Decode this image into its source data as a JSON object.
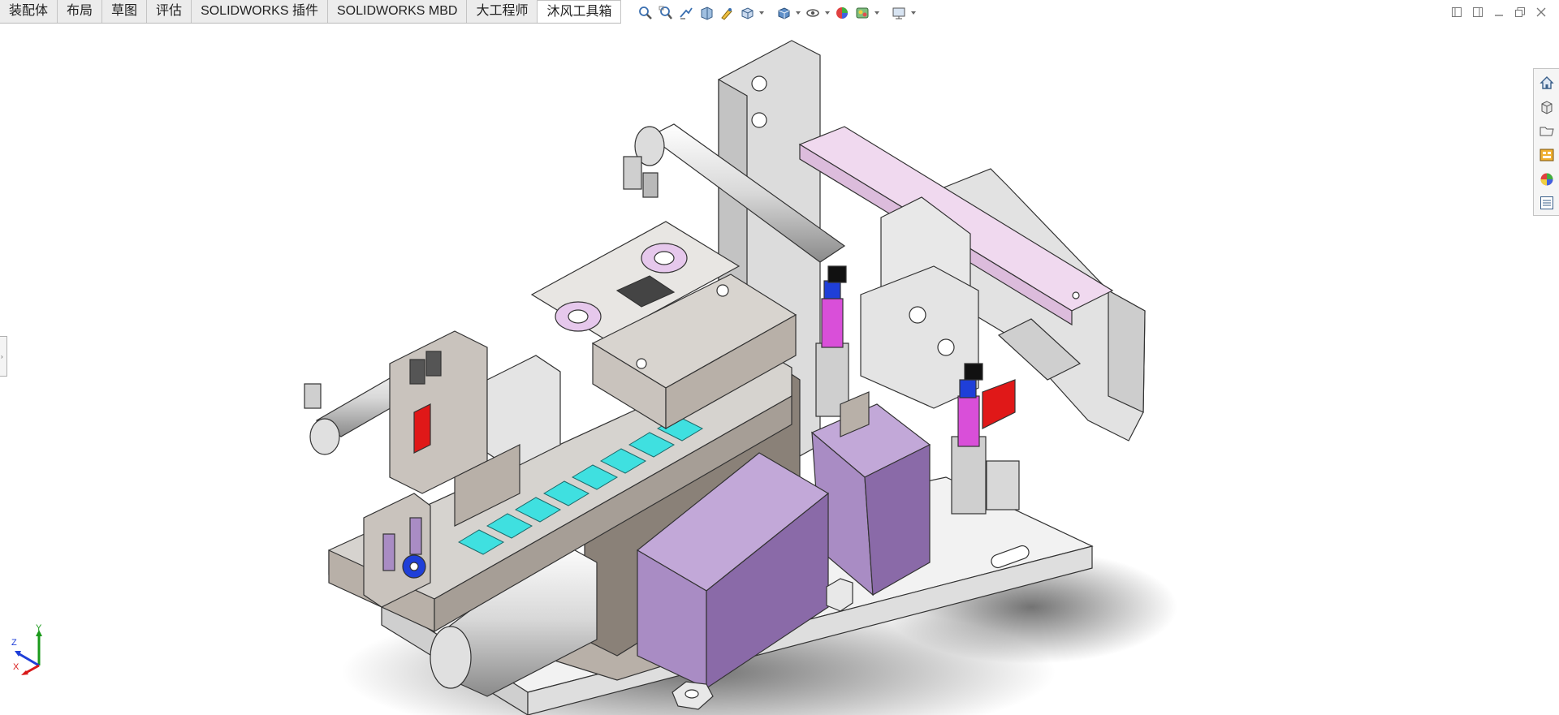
{
  "tabs": [
    {
      "label": "装配体",
      "active": false
    },
    {
      "label": "布局",
      "active": false
    },
    {
      "label": "草图",
      "active": false
    },
    {
      "label": "评估",
      "active": false
    },
    {
      "label": "SOLIDWORKS 插件",
      "active": false
    },
    {
      "label": "SOLIDWORKS MBD",
      "active": false
    },
    {
      "label": "大工程师",
      "active": false
    },
    {
      "label": "沐风工具箱",
      "active": true
    }
  ],
  "hud_toolbar": [
    "zoom-to-fit-icon",
    "zoom-to-area-icon",
    "previous-view-icon",
    "section-view-icon",
    "dynamic-annotation-icon",
    "view-orientation-icon",
    "display-style-icon",
    "hide-show-items-icon",
    "edit-appearance-icon",
    "apply-scene-icon",
    "view-settings-icon"
  ],
  "task_pane": [
    "solidworks-resources-icon",
    "design-library-icon",
    "file-explorer-icon",
    "view-palette-icon",
    "appearances-scenes-icon",
    "custom-properties-icon"
  ],
  "triad": {
    "x": "X",
    "y": "Y",
    "z": "Z"
  },
  "colors": {
    "part_gray": "#d6d3cf",
    "part_dark": "#8a8178",
    "bin_purple": "#a98cc4",
    "bin_purple_dark": "#8a6aa8",
    "plate_pink": "#f0d9ef",
    "parts_cyan": "#3fe0e0",
    "spring_magenta": "#d94fd9",
    "accent_red": "#e01818",
    "accent_blue": "#1f3fd8"
  }
}
